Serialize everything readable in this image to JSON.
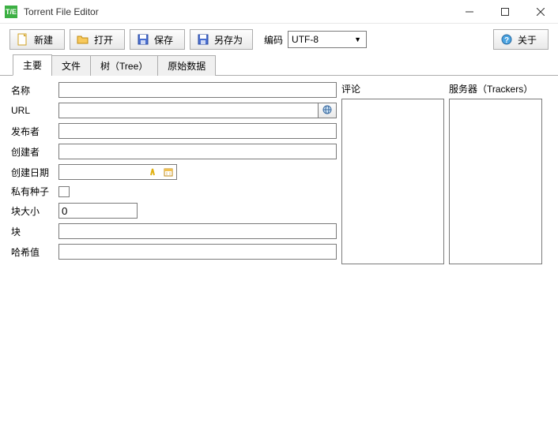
{
  "window": {
    "title": "Torrent File Editor",
    "logo_text": "T/E"
  },
  "toolbar": {
    "new_label": "新建",
    "open_label": "打开",
    "save_label": "保存",
    "saveas_label": "另存为",
    "encoding_label": "编码",
    "encoding_value": "UTF-8",
    "about_label": "关于"
  },
  "tabs": [
    {
      "label": "主要"
    },
    {
      "label": "文件"
    },
    {
      "label": "树（Tree）"
    },
    {
      "label": "原始数据"
    }
  ],
  "form": {
    "name_label": "名称",
    "name_value": "",
    "url_label": "URL",
    "url_value": "",
    "publisher_label": "发布者",
    "publisher_value": "",
    "creator_label": "创建者",
    "creator_value": "",
    "created_label": "创建日期",
    "created_value": "",
    "private_label": "私有种子",
    "private_checked": false,
    "piecesize_label": "块大小",
    "piecesize_value": "0",
    "pieces_label": "块",
    "pieces_value": "",
    "hash_label": "哈希值",
    "hash_value": ""
  },
  "columns": {
    "comments_label": "评论",
    "trackers_label": "服务器（Trackers）"
  }
}
